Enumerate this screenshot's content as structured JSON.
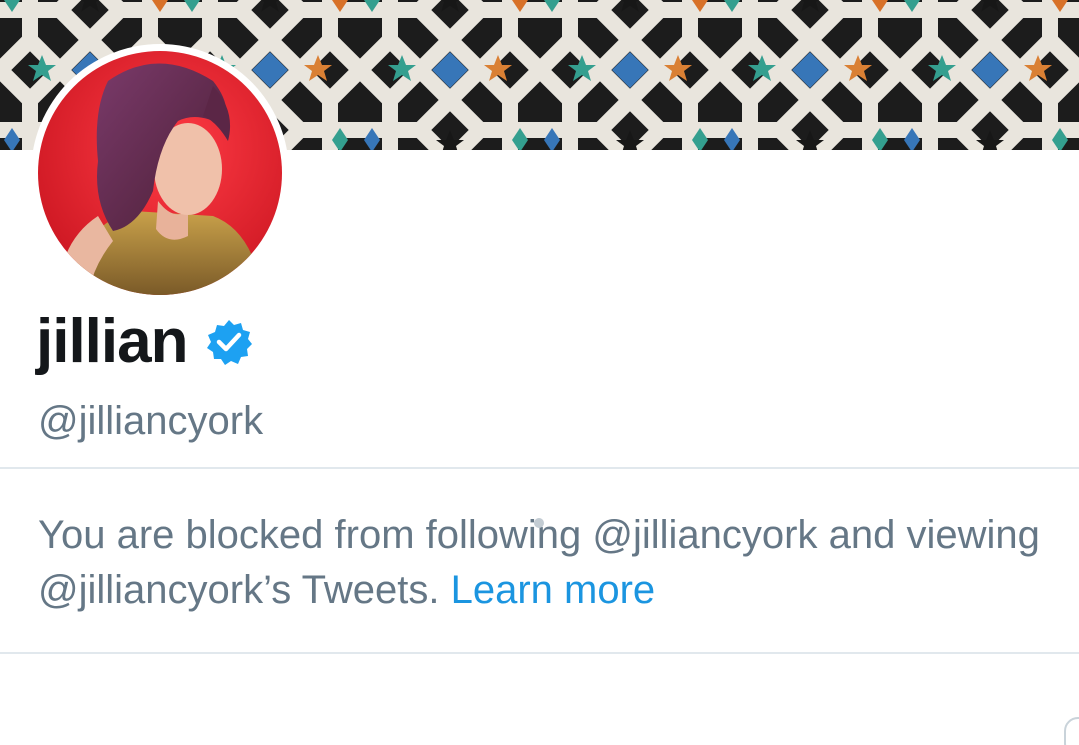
{
  "profile": {
    "display_name": "jillian",
    "handle": "@jilliancyork",
    "verified": true,
    "banner_description_icon": "moroccan-tile-banner",
    "avatar_icon": "profile-photo"
  },
  "blocked_notice": {
    "message": "You are blocked from following @jilliancyork and viewing @jilliancyork’s Tweets.",
    "learn_more_label": "Learn more"
  },
  "colors": {
    "name_text": "#14171a",
    "secondary_text": "#657786",
    "link": "#1b95e0",
    "verified_badge": "#1da1f2",
    "divider": "#e1e8ed"
  }
}
